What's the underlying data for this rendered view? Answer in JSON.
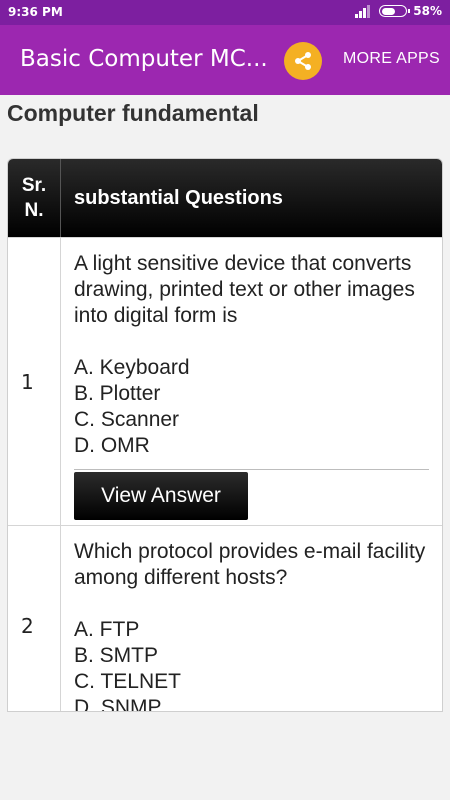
{
  "status_bar": {
    "time": "9:36 PM",
    "battery": "58%",
    "battery_level": 0.58
  },
  "app_bar": {
    "title": "Basic Computer MC...",
    "share_icon": "share-icon",
    "more_apps_label": "MORE APPS",
    "background": "#9c27b0",
    "share_color": "#f4b023"
  },
  "section": {
    "heading": "Computer fundamental"
  },
  "table": {
    "headers": {
      "sr_line1": "Sr.",
      "sr_line2": "N.",
      "question": "substantial Questions"
    },
    "rows": [
      {
        "number": "1",
        "question": "A light sensitive device that converts drawing, printed text or other images into digital form is",
        "options": [
          "A. Keyboard",
          "B. Plotter",
          "C. Scanner",
          "D. OMR"
        ],
        "button_label": "View Answer"
      },
      {
        "number": "2",
        "question": "Which protocol provides e-mail facility among different hosts?",
        "options": [
          "A. FTP",
          "B. SMTP",
          "C. TELNET",
          "D. SNMP"
        ]
      }
    ]
  }
}
